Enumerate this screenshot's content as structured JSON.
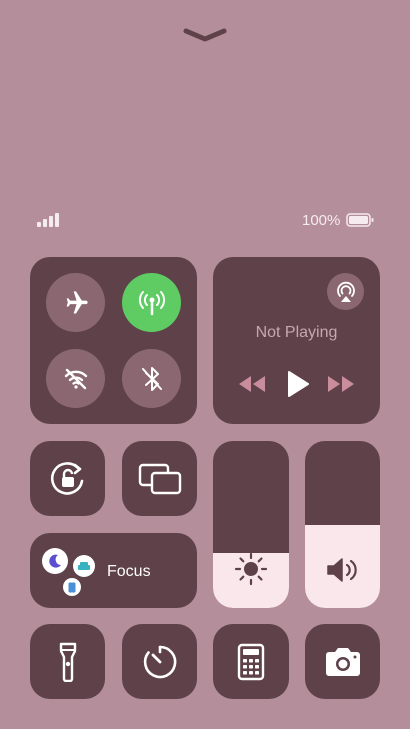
{
  "status_bar": {
    "battery_text": "100%",
    "signal_icon": "cellular-signal-icon",
    "battery_icon": "battery-full-icon"
  },
  "header": {
    "dismiss_icon": "chevron-down-icon"
  },
  "connectivity": {
    "airplane_mode": false,
    "cellular_data": true,
    "wifi": false,
    "bluetooth": false
  },
  "now_playing": {
    "title": "Not Playing",
    "icons": [
      "airplay-icon",
      "rewind-icon",
      "play-icon",
      "fast-forward-icon"
    ]
  },
  "focus": {
    "label": "Focus"
  },
  "sliders": {
    "brightness_level": 0.33,
    "volume_level": 0.5
  },
  "bottom_row": [
    "flashlight-icon",
    "timer-icon",
    "calculator-icon",
    "camera-icon"
  ],
  "colors": {
    "background": "#b48e9b",
    "tile": "#5e4149",
    "toggle_off": "#8b6871",
    "toggle_on": "#5fcb63",
    "slider_fill": "#f9e7ec"
  }
}
